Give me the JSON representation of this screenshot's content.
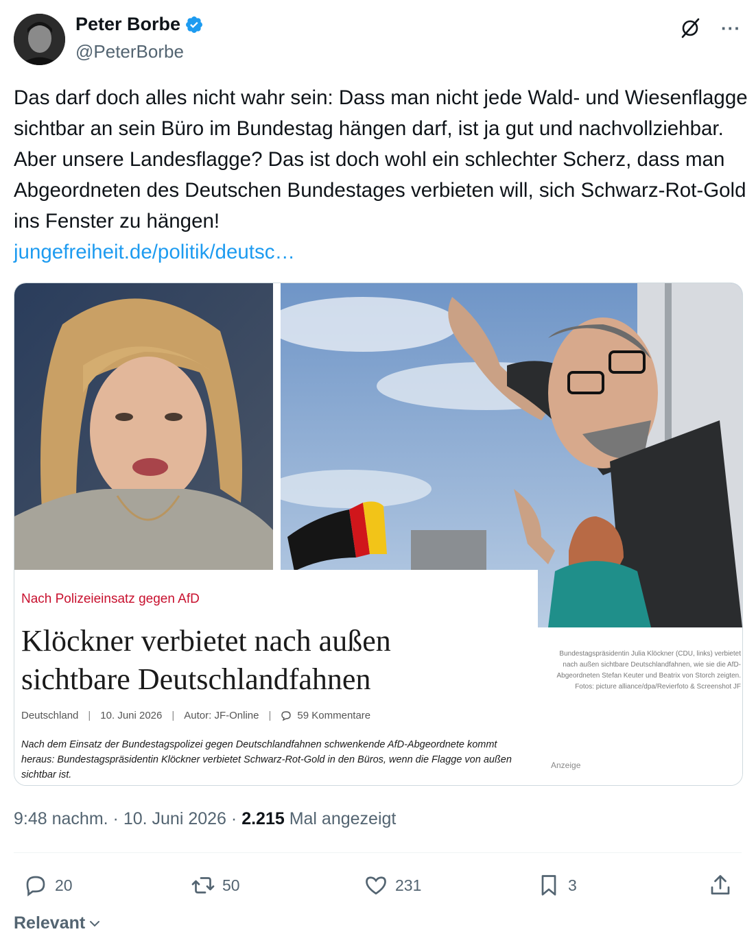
{
  "author": {
    "display_name": "Peter Borbe",
    "handle": "@PeterBorbe",
    "verified_icon": "verified-badge-icon",
    "avatar_icon": "avatar"
  },
  "top_actions": {
    "grok_icon": "grok-icon",
    "more_label": "···"
  },
  "tweet": {
    "text": "Das darf doch alles nicht wahr sein: Dass man nicht jede Wald- und Wiesenflagge sichtbar an sein Büro im Bundestag hängen darf, ist ja gut und nachvollziehbar. Aber unsere Landesflagge? Das ist doch wohl ein schlechter Scherz, dass man Abgeordneten des Deutschen Bundestages verbieten will, sich Schwarz-Rot-Gold ins Fenster zu hängen!",
    "link": "jungefreiheit.de/politik/deutsc…"
  },
  "card": {
    "kicker": "Nach Polizeieinsatz gegen AfD",
    "headline": "Klöckner verbietet nach außen sichtbare Deutschlandfahnen",
    "meta": {
      "section": "Deutschland",
      "date": "10. Juni 2026",
      "author": "Autor: JF-Online",
      "comments": "59 Kommentare"
    },
    "teaser": "Nach dem Einsatz der Bundestagspolizei gegen Deutschlandfahnen schwenkende AfD-Abgeordnete kommt heraus: Bundestagspräsidentin Klöckner verbietet Schwarz-Rot-Gold in den Büros, wenn die Flagge von außen sichtbar ist.",
    "caption": "Bundestagspräsidentin Julia Klöckner (CDU, links) verbietet nach außen sichtbare Deutschlandfahnen, wie sie die AfD-Abgeordneten Stefan Keuter und Beatrix von Storch zeigten. Fotos: picture alliance/dpa/Revierfoto & Screenshot JF",
    "ad_label": "Anzeige"
  },
  "stats": {
    "time": "9:48 nachm.",
    "date": "10. Juni 2026",
    "views_count": "2.215",
    "views_label": "Mal angezeigt"
  },
  "actions": {
    "replies": "20",
    "reposts": "50",
    "likes": "231",
    "bookmarks": "3"
  },
  "sort_label": "Relevant",
  "colors": {
    "link": "#1d9bf0",
    "kicker": "#c8102e",
    "muted": "#536471"
  }
}
